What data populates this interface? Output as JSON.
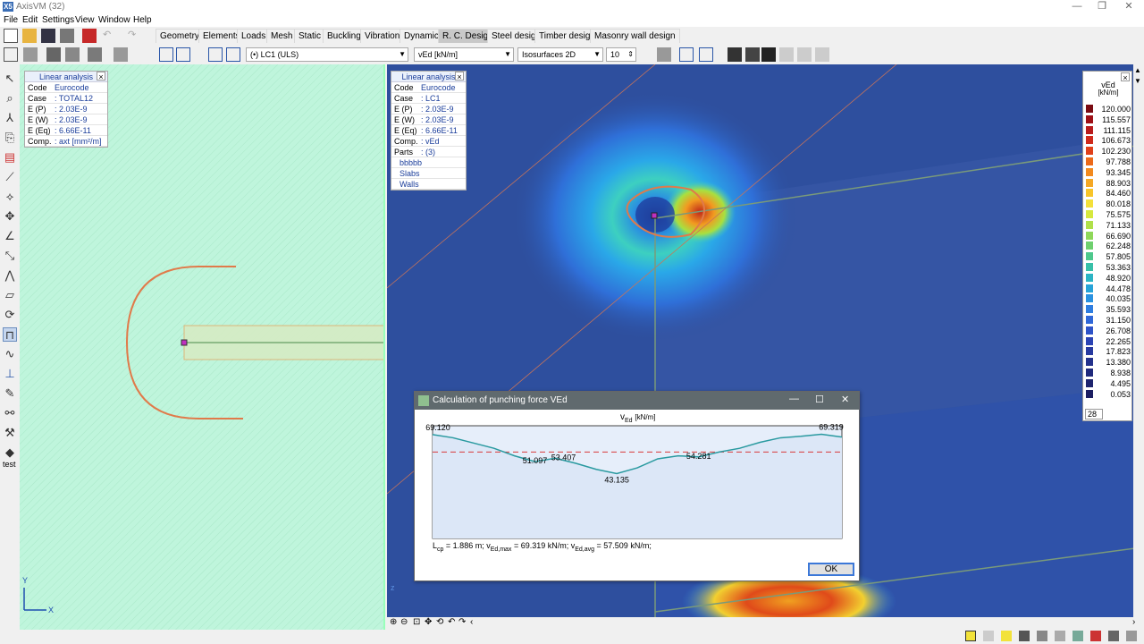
{
  "window": {
    "title": "AxisVM (32)",
    "logo": "X5"
  },
  "menu": [
    "File",
    "Edit",
    "Settings",
    "View",
    "Window",
    "Help"
  ],
  "tabs": [
    "Geometry",
    "Elements",
    "Loads",
    "Mesh",
    "Static",
    "Buckling",
    "Vibration",
    "Dynamic",
    "R. C. Design",
    "Steel design",
    "Timber design",
    "Masonry wall design"
  ],
  "active_tab": "R. C. Design",
  "toolbar": {
    "loadcase": "(•) LC1 (ULS)",
    "component": "vEd [kN/m]",
    "display_mode": "Isosurfaces 2D",
    "count": "10"
  },
  "left_tools_label": "test",
  "left_info": {
    "header": "Linear analysis",
    "rows": [
      {
        "k": "Code",
        "v": "Eurocode"
      },
      {
        "k": "Case",
        "v": ": TOTAL12"
      },
      {
        "k": "E (P)",
        "v": ": 2.03E-9"
      },
      {
        "k": "E (W)",
        "v": ": 2.03E-9"
      },
      {
        "k": "E (Eq)",
        "v": ": 6.66E-11"
      },
      {
        "k": "Comp.",
        "v": ": axt [mm²/m]"
      }
    ]
  },
  "right_info": {
    "header": "Linear analysis",
    "rows": [
      {
        "k": "Code",
        "v": "Eurocode"
      },
      {
        "k": "Case",
        "v": ": LC1"
      },
      {
        "k": "E (P)",
        "v": ": 2.03E-9"
      },
      {
        "k": "E (W)",
        "v": ": 2.03E-9"
      },
      {
        "k": "E (Eq)",
        "v": ": 6.66E-11"
      },
      {
        "k": "Comp.",
        "v": ": vEd"
      },
      {
        "k": "Parts",
        "v": ": (3)"
      },
      {
        "k": "",
        "v": "bbbbb"
      },
      {
        "k": "",
        "v": "Slabs"
      },
      {
        "k": "",
        "v": "Walls"
      }
    ]
  },
  "legend": {
    "title": "vEd",
    "unit": "[kN/m]",
    "values": [
      "120.000",
      "115.557",
      "111.115",
      "106.673",
      "102.230",
      "97.788",
      "93.345",
      "88.903",
      "84.460",
      "80.018",
      "75.575",
      "71.133",
      "66.690",
      "62.248",
      "57.805",
      "53.363",
      "48.920",
      "44.478",
      "40.035",
      "35.593",
      "31.150",
      "26.708",
      "22.265",
      "17.823",
      "13.380",
      "8.938",
      "4.495",
      "0.053"
    ],
    "colors": [
      "#7a0b12",
      "#9e1016",
      "#b81c1c",
      "#cf2a1c",
      "#e0401a",
      "#ec6a1a",
      "#f28a1f",
      "#f5a825",
      "#f8c52a",
      "#f4e03a",
      "#d6e83e",
      "#b0e04a",
      "#8fd85a",
      "#6fd06e",
      "#4ec88c",
      "#38c0a8",
      "#2cb4c4",
      "#28a4d8",
      "#2a92e0",
      "#2f7ee0",
      "#3068d8",
      "#2f54c8",
      "#2c44b4",
      "#283aa0",
      "#24328c",
      "#202a7c",
      "#1e246e",
      "#1c1e62"
    ],
    "count": "28"
  },
  "dialog": {
    "title": "Calculation of punching force VEd",
    "chart_title": "v",
    "chart_title_sub": "Ed",
    "chart_unit": "[kN/m]",
    "footer": "L",
    "footer_sub1": "cp",
    "footer_part1": " = 1.886 m; v",
    "footer_sub2": "Ed,max",
    "footer_part2": " = 69.319 kN/m; v",
    "footer_sub3": "Ed,avg",
    "footer_part3": " = 57.509 kN/m;",
    "ok_label": "OK"
  },
  "chart_data": {
    "type": "line",
    "ylim": [
      0,
      75
    ],
    "average": 57.509,
    "x": [
      0,
      0.05,
      0.1,
      0.15,
      0.2,
      0.25,
      0.3,
      0.35,
      0.4,
      0.45,
      0.5,
      0.55,
      0.6,
      0.65,
      0.7,
      0.75,
      0.8,
      0.85,
      0.9,
      0.95,
      1.0
    ],
    "values": [
      69.12,
      67.0,
      63.5,
      60.0,
      55.0,
      51.097,
      53.407,
      50.0,
      46.0,
      43.135,
      47.0,
      53.0,
      55.0,
      54.281,
      57.5,
      60.0,
      64.0,
      67.0,
      68.0,
      69.319,
      67.5
    ],
    "data_labels": [
      {
        "x": 0.0,
        "text": "69.120"
      },
      {
        "x": 0.25,
        "text": "51.097"
      },
      {
        "x": 0.32,
        "text": "53.407"
      },
      {
        "x": 0.45,
        "text": "43.135"
      },
      {
        "x": 0.65,
        "text": "54.281"
      },
      {
        "x": 0.95,
        "text": "69.319"
      }
    ]
  },
  "axes_label": {
    "y": "Y",
    "x": "X"
  }
}
